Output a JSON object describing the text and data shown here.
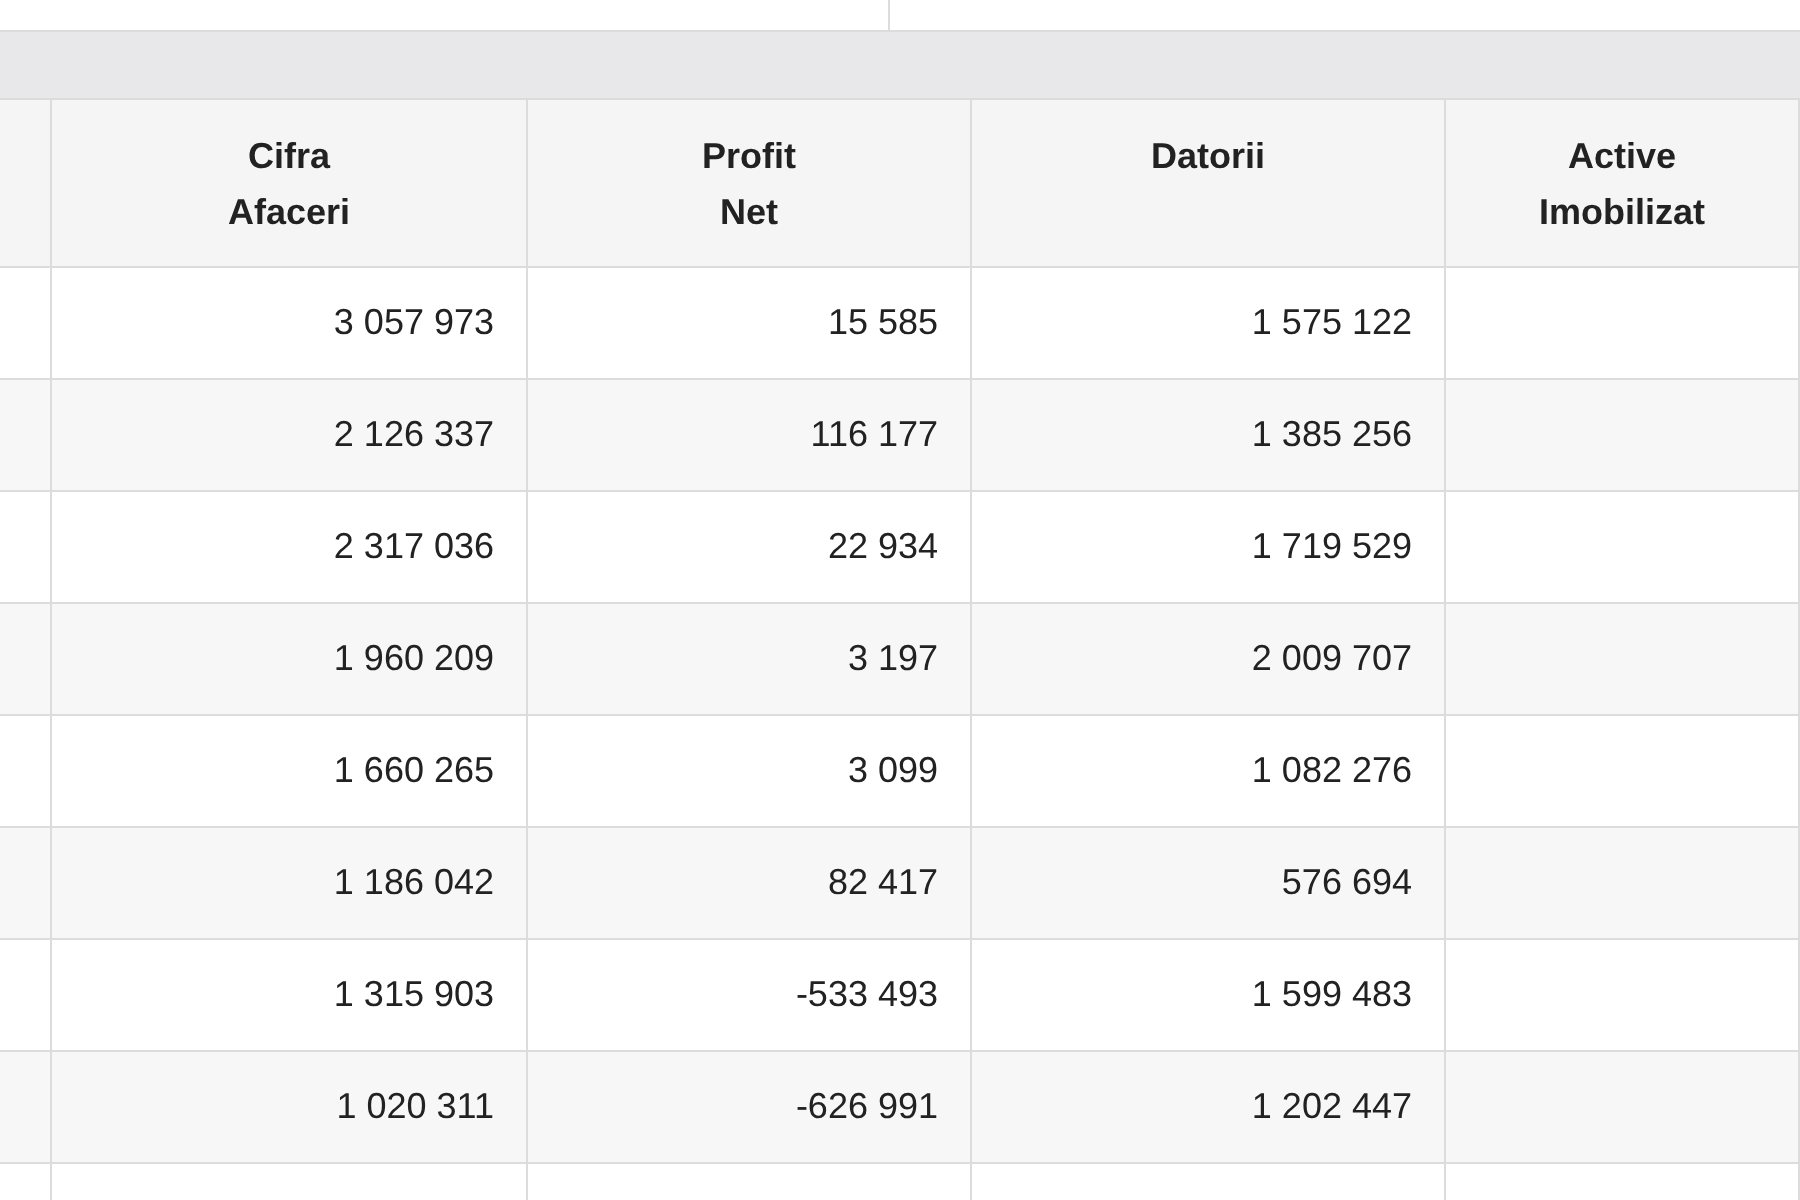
{
  "table": {
    "columns": [
      {
        "lines": [
          "Cifra",
          "Afaceri"
        ]
      },
      {
        "lines": [
          "Profit",
          "Net"
        ]
      },
      {
        "lines": [
          "Datorii"
        ]
      },
      {
        "lines": [
          "Active",
          "Imobilizat"
        ]
      }
    ],
    "rows": [
      [
        "3 057 973",
        "15 585",
        "1 575 122"
      ],
      [
        "2 126 337",
        "116 177",
        "1 385 256"
      ],
      [
        "2 317 036",
        "22 934",
        "1 719 529"
      ],
      [
        "1 960 209",
        "3 197",
        "2 009 707"
      ],
      [
        "1 660 265",
        "3 099",
        "1 082 276"
      ],
      [
        "1 186 042",
        "82 417",
        "576 694"
      ],
      [
        "1 315 903",
        "-533 493",
        "1 599 483"
      ],
      [
        "1 020 311",
        "-626 991",
        "1 202 447"
      ]
    ]
  }
}
